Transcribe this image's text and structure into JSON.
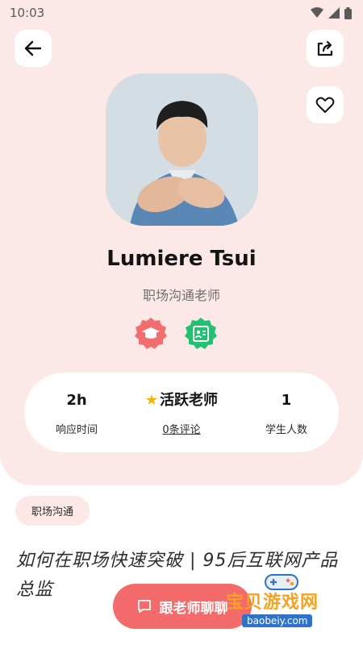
{
  "status_bar": {
    "time": "10:03"
  },
  "header": {
    "back_icon": "arrow-left-icon",
    "share_icon": "share-icon",
    "favorite_icon": "heart-outline-icon"
  },
  "profile": {
    "name": "Lumiere Tsui",
    "title": "职场沟通老师",
    "badges": [
      "graduation-cap-icon",
      "id-card-icon"
    ],
    "badge_colors": {
      "edu": "#f26d6d",
      "id": "#22c172"
    }
  },
  "stats": [
    {
      "value": "2h",
      "label": "响应时间"
    },
    {
      "value": "活跃老师",
      "label": "0条评论"
    },
    {
      "value": "1",
      "label": "学生人数"
    }
  ],
  "tag": "职场沟通",
  "headline": "如何在职场快速突破 | 95后互联网产品总监",
  "chat_button": {
    "label": "跟老师聊聊",
    "color": "#f46b6b"
  },
  "watermark": {
    "title": "宝贝游戏网",
    "domain": "baobeiy.com"
  },
  "colors": {
    "background_tint": "#fde8e8",
    "accent_star": "#f4b400"
  }
}
